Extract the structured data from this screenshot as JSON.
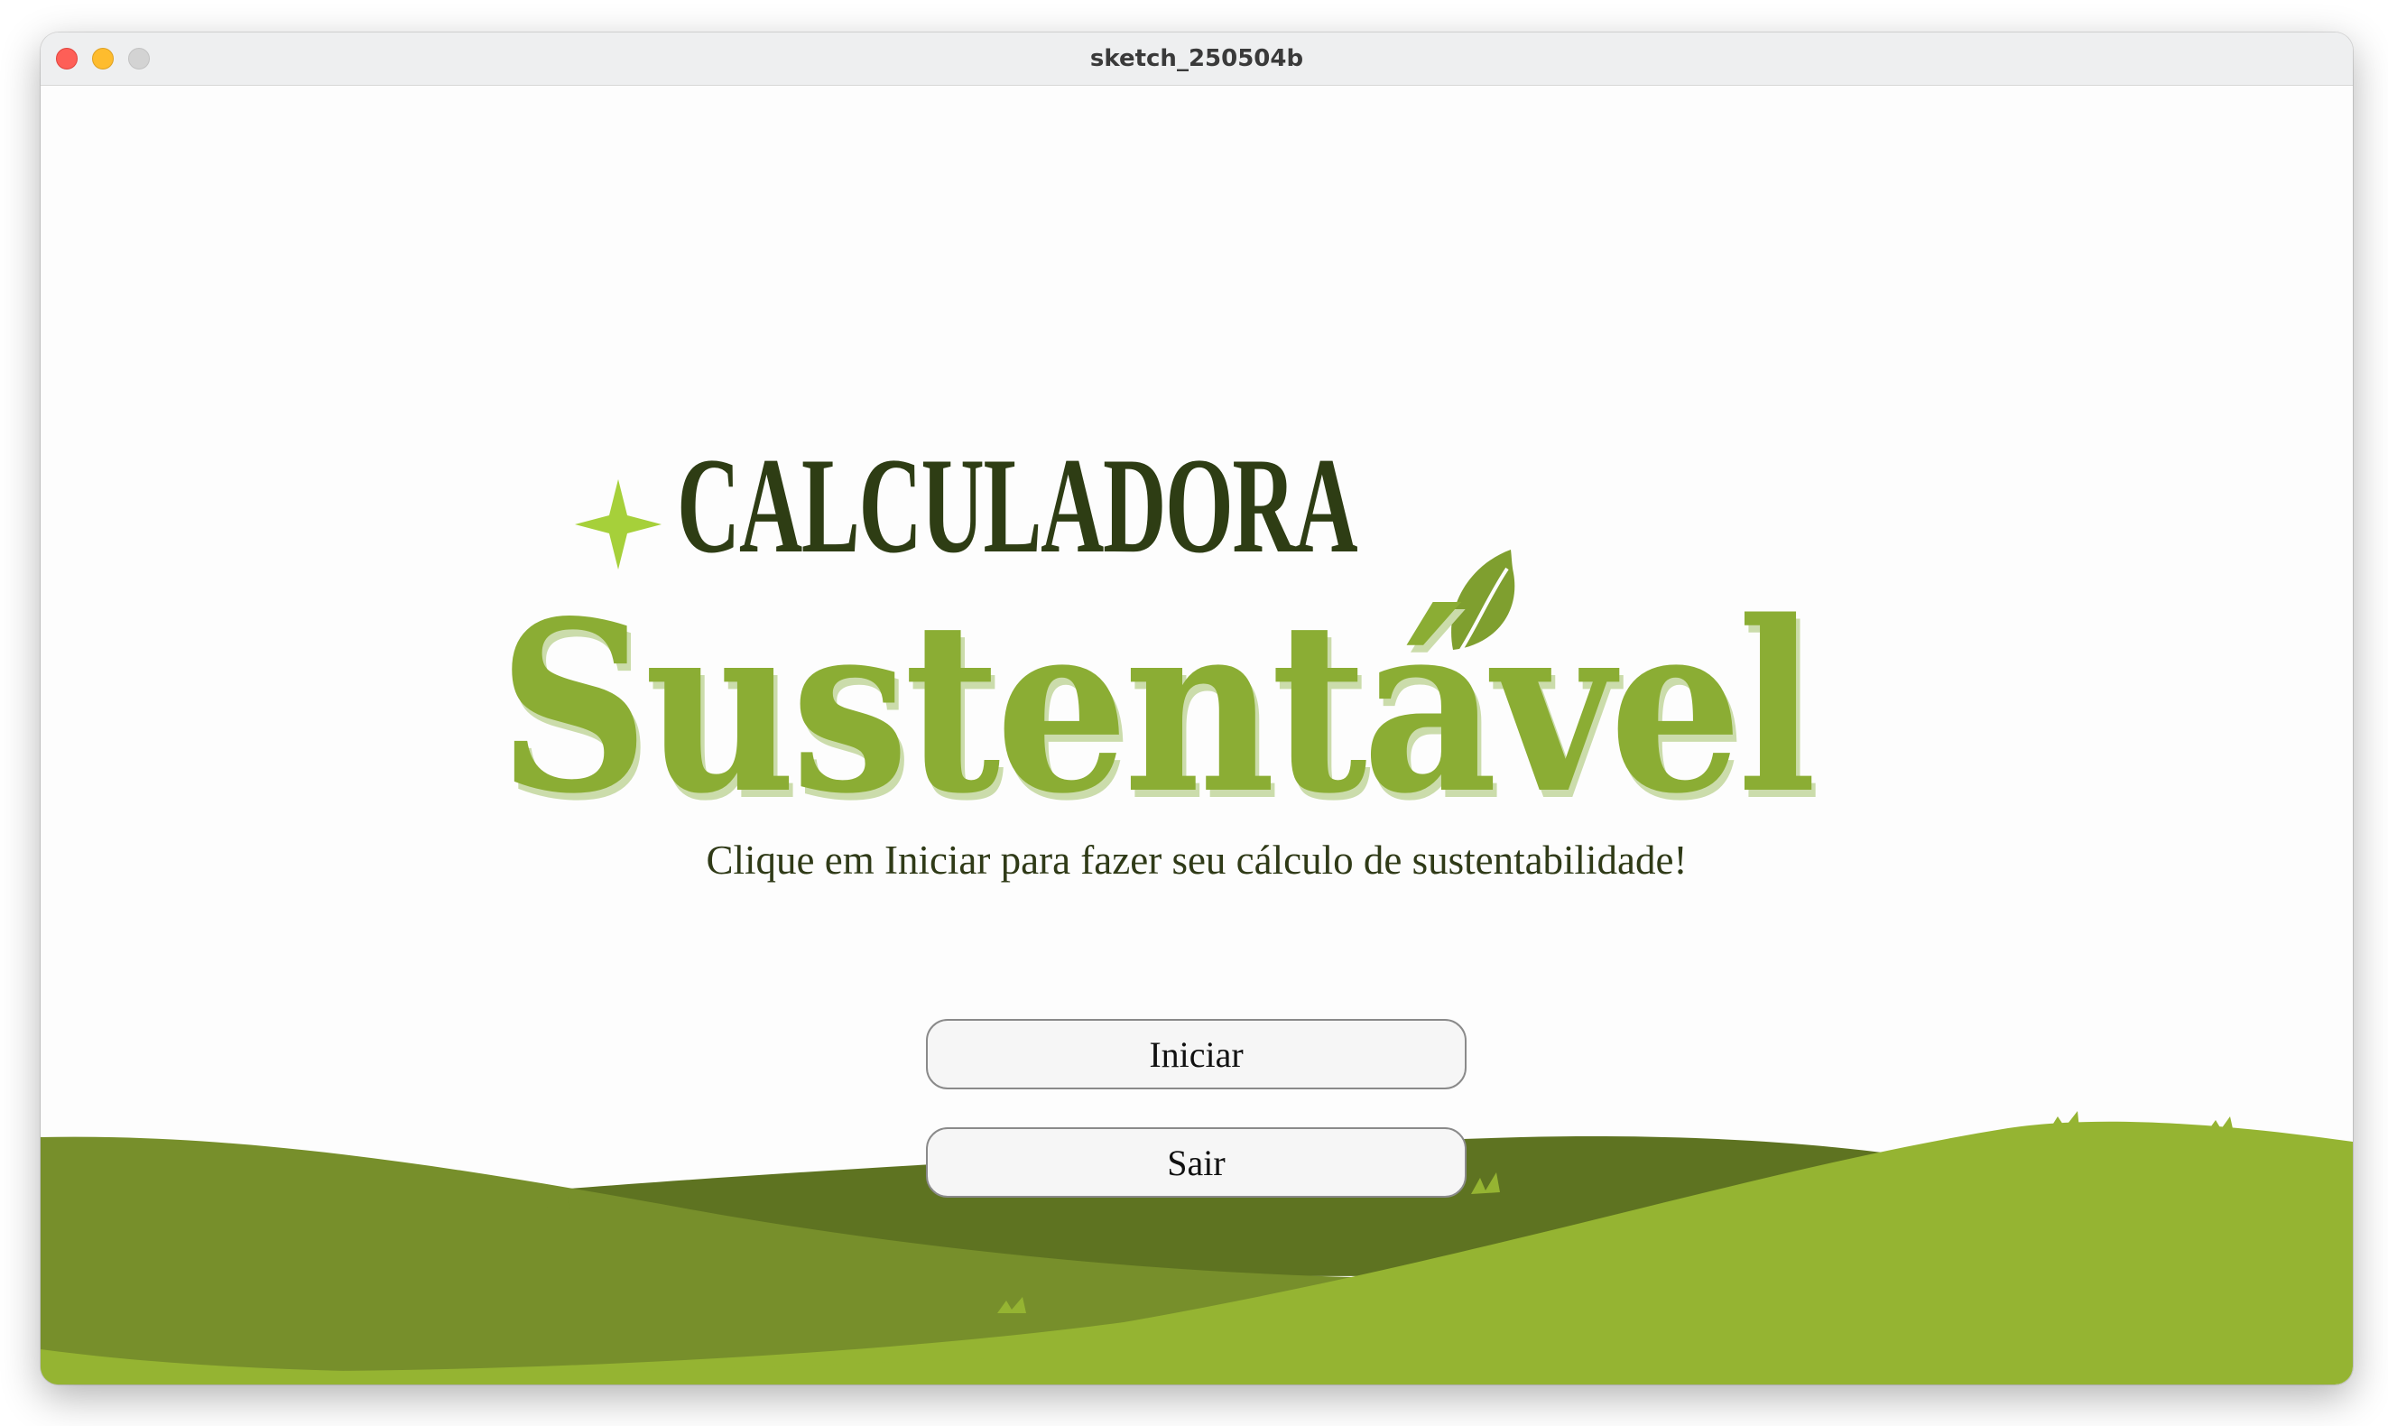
{
  "window": {
    "title": "sketch_250504b",
    "controls": [
      "close",
      "minimize",
      "zoom"
    ]
  },
  "logo": {
    "title": "CALCULADORA",
    "word": "Sustentável",
    "icons": [
      "sparkle-icon",
      "leaf-icon"
    ]
  },
  "subtitle": "Clique em Iniciar para fazer seu cálculo de sustentabilidade!",
  "buttons": {
    "start": "Iniciar",
    "exit": "Sair"
  },
  "colors": {
    "title_dark_green": "#2e3d14",
    "word_green": "#8bad34",
    "hill_light": "#95b432",
    "hill_mid": "#778f2b",
    "hill_dark": "#5e7321",
    "sparkle": "#a6d03a"
  }
}
